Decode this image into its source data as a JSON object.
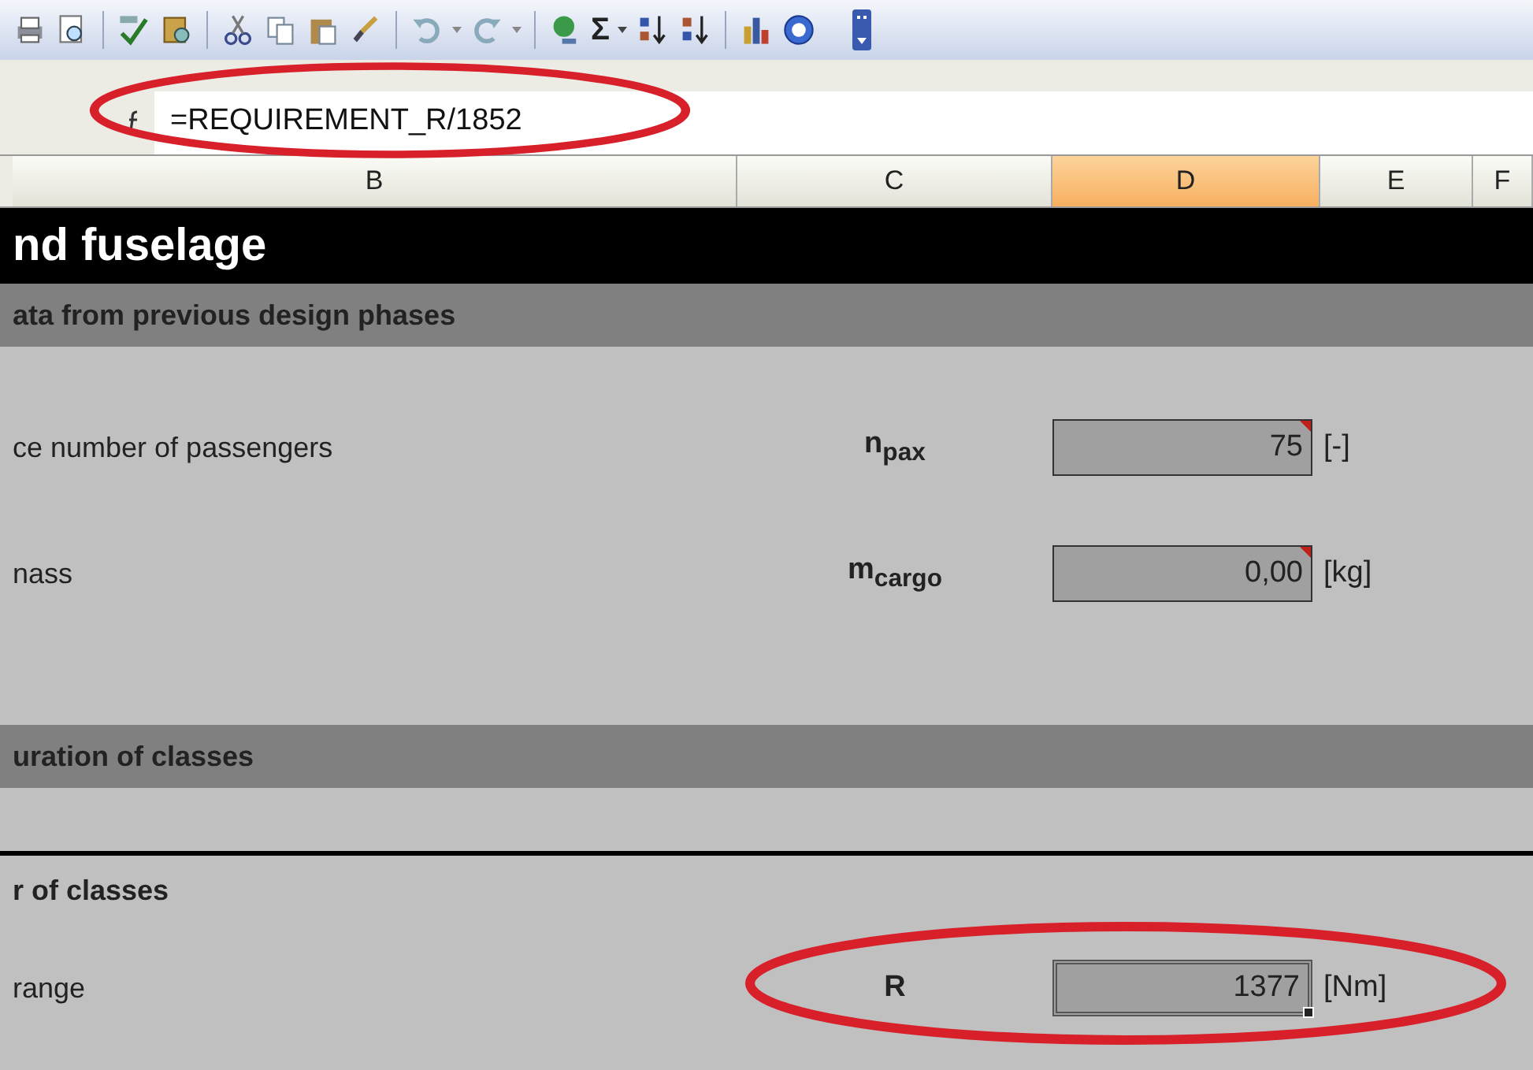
{
  "toolbar": {
    "sum_symbol": "Σ"
  },
  "formula_bar": {
    "formula": "=REQUIREMENT_R/1852"
  },
  "column_headers": [
    {
      "label": "B",
      "selected": false
    },
    {
      "label": "C",
      "selected": false
    },
    {
      "label": "D",
      "selected": true
    },
    {
      "label": "E",
      "selected": false
    },
    {
      "label": "F",
      "selected": false
    }
  ],
  "rows": [
    {
      "kind": "title",
      "text": "nd fuselage"
    },
    {
      "kind": "section",
      "text": "ata from previous design phases"
    },
    {
      "kind": "gap"
    },
    {
      "kind": "param",
      "label": "ce number of passengers",
      "symbol": "n$_{pax}$",
      "value": "75",
      "unit": "[-]",
      "comment": true,
      "selected": false
    },
    {
      "kind": "param",
      "label": "nass",
      "symbol": "m$_{cargo}$",
      "value": "0,00",
      "unit": "[kg]",
      "comment": true,
      "selected": false
    },
    {
      "kind": "gap"
    },
    {
      "kind": "section",
      "text": "uration of classes"
    },
    {
      "kind": "gap"
    },
    {
      "kind": "subhead",
      "text": "r of classes"
    },
    {
      "kind": "param",
      "label": "range",
      "symbol": "R",
      "value": "1377",
      "unit": "[Nm]",
      "comment": false,
      "selected": true
    }
  ]
}
